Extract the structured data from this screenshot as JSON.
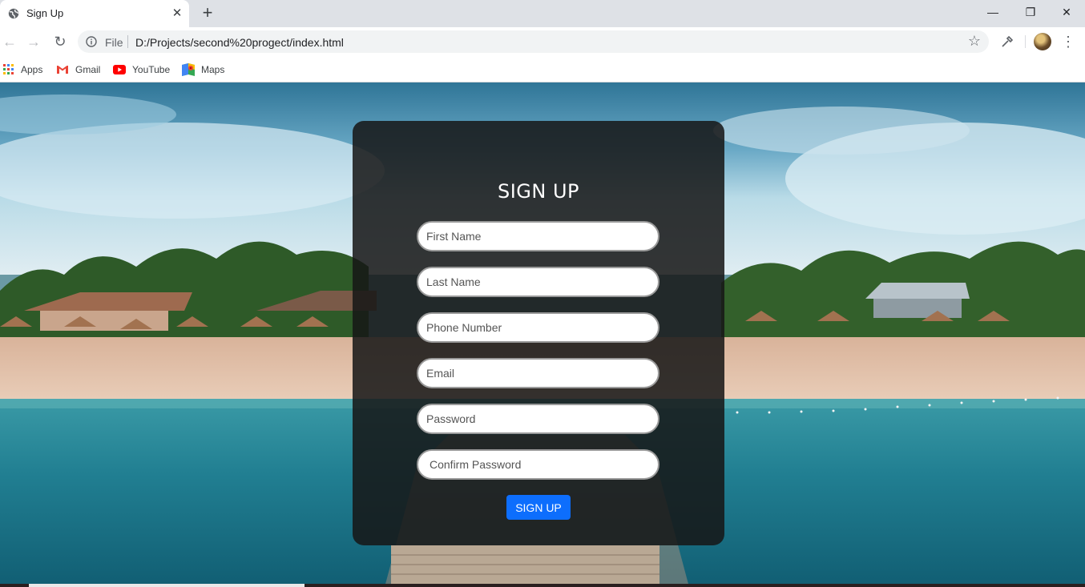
{
  "browser": {
    "tab_title": "Sign Up",
    "address_scheme": "File",
    "address_url": "D:/Projects/second%20progect/index.html",
    "bookmarks": [
      {
        "label": "Apps",
        "icon": "apps-grid-icon"
      },
      {
        "label": "Gmail",
        "icon": "gmail-icon"
      },
      {
        "label": "YouTube",
        "icon": "youtube-icon"
      },
      {
        "label": "Maps",
        "icon": "maps-icon"
      }
    ]
  },
  "form": {
    "title": "SIGN UP",
    "fields": {
      "first_name": {
        "placeholder": "First Name",
        "value": ""
      },
      "last_name": {
        "placeholder": "Last Name",
        "value": ""
      },
      "phone": {
        "placeholder": "Phone Number",
        "value": ""
      },
      "email": {
        "placeholder": "Email",
        "value": ""
      },
      "password": {
        "placeholder": "Password",
        "value": ""
      },
      "confirm_password": {
        "placeholder": "Confirm Password",
        "value": ""
      }
    },
    "submit_label": "SIGN UP"
  },
  "colors": {
    "button": "#0d6efd",
    "card": "#161616",
    "chrome_tabstrip": "#dee1e6"
  }
}
